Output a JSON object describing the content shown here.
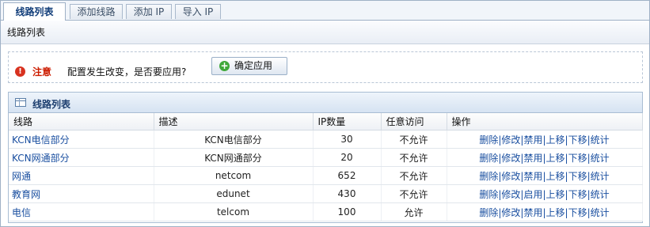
{
  "tabs": [
    {
      "label": "线路列表",
      "active": true
    },
    {
      "label": "添加线路",
      "active": false
    },
    {
      "label": "添加 IP",
      "active": false
    },
    {
      "label": "导入 IP",
      "active": false
    }
  ],
  "subheader": {
    "title": "线路列表"
  },
  "notice": {
    "label": "注意",
    "message": "配置发生改变，是否要应用?",
    "apply_button": "确定应用"
  },
  "panel": {
    "title": "线路列表",
    "columns": [
      "线路",
      "描述",
      "IP数量",
      "任意访问",
      "操作"
    ],
    "rows": [
      {
        "name": "KCN电信部分",
        "desc": "KCN电信部分",
        "ip_count": "30",
        "access": "不允许",
        "ops": [
          "删除",
          "修改",
          "禁用",
          "上移",
          "下移",
          "统计"
        ]
      },
      {
        "name": "KCN网通部分",
        "desc": "KCN网通部分",
        "ip_count": "20",
        "access": "不允许",
        "ops": [
          "删除",
          "修改",
          "禁用",
          "上移",
          "下移",
          "统计"
        ]
      },
      {
        "name": "网通",
        "desc": "netcom",
        "ip_count": "652",
        "access": "不允许",
        "ops": [
          "删除",
          "修改",
          "禁用",
          "上移",
          "下移",
          "统计"
        ]
      },
      {
        "name": "教育网",
        "desc": "edunet",
        "ip_count": "430",
        "access": "不允许",
        "ops": [
          "删除",
          "修改",
          "启用",
          "上移",
          "下移",
          "统计"
        ]
      },
      {
        "name": "电信",
        "desc": "telcom",
        "ip_count": "100",
        "access": "允许",
        "ops": [
          "删除",
          "修改",
          "禁用",
          "上移",
          "下移",
          "统计"
        ]
      }
    ]
  }
}
